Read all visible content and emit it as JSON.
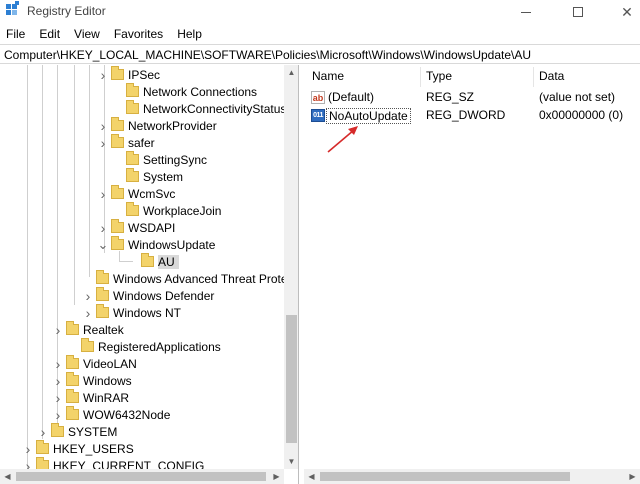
{
  "window": {
    "title": "Registry Editor",
    "accent": "#2d7fd3"
  },
  "menu": [
    "File",
    "Edit",
    "View",
    "Favorites",
    "Help"
  ],
  "address": "Computer\\HKEY_LOCAL_MACHINE\\SOFTWARE\\Policies\\Microsoft\\Windows\\WindowsUpdate\\AU",
  "tree": [
    {
      "label": "IPSec",
      "chevron": "right"
    },
    {
      "label": "Network Connections",
      "chevron": ""
    },
    {
      "label": "NetworkConnectivityStatusIndi",
      "chevron": ""
    },
    {
      "label": "NetworkProvider",
      "chevron": "right"
    },
    {
      "label": "safer",
      "chevron": "right"
    },
    {
      "label": "SettingSync",
      "chevron": ""
    },
    {
      "label": "System",
      "chevron": ""
    },
    {
      "label": "WcmSvc",
      "chevron": "right"
    },
    {
      "label": "WorkplaceJoin",
      "chevron": ""
    },
    {
      "label": "WSDAPI",
      "chevron": "right"
    },
    {
      "label": "WindowsUpdate",
      "chevron": "down"
    },
    {
      "label": "AU",
      "chevron": "",
      "selected": true
    },
    {
      "label": "Windows Advanced Threat Protect",
      "chevron": ""
    },
    {
      "label": "Windows Defender",
      "chevron": "right"
    },
    {
      "label": "Windows NT",
      "chevron": "right"
    },
    {
      "label": "Realtek",
      "chevron": "right"
    },
    {
      "label": "RegisteredApplications",
      "chevron": ""
    },
    {
      "label": "VideoLAN",
      "chevron": "right"
    },
    {
      "label": "Windows",
      "chevron": "right"
    },
    {
      "label": "WinRAR",
      "chevron": "right"
    },
    {
      "label": "WOW6432Node",
      "chevron": "right"
    },
    {
      "label": "SYSTEM",
      "chevron": "right"
    },
    {
      "label": "HKEY_USERS",
      "chevron": "right"
    },
    {
      "label": "HKEY_CURRENT_CONFIG",
      "chevron": "right"
    }
  ],
  "values": {
    "headers": {
      "name": "Name",
      "type": "Type",
      "data": "Data"
    },
    "rows": [
      {
        "icon": "string-value-icon",
        "icon_text": "ab",
        "name": "(Default)",
        "type": "REG_SZ",
        "data": "(value not set)"
      },
      {
        "icon": "dword-value-icon",
        "icon_text": "011",
        "name": "NoAutoUpdate",
        "type": "REG_DWORD",
        "data": "0x00000000 (0)"
      }
    ]
  },
  "annotation_color": "#d62a2a"
}
